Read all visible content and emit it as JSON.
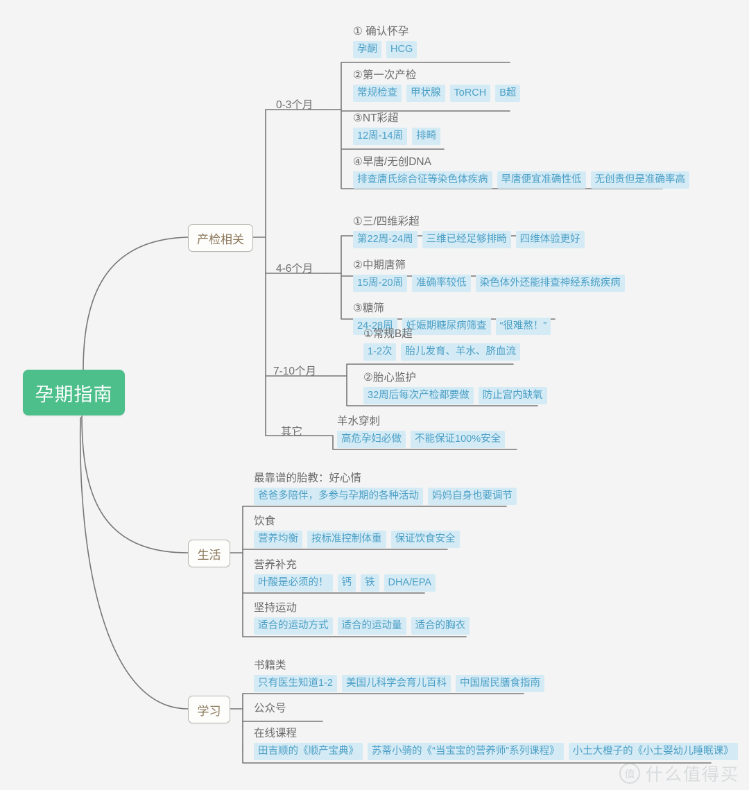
{
  "root": {
    "label": "孕期指南",
    "color": "#4cbf8b"
  },
  "theme": {
    "background": "#f4f4f4",
    "tag_background": "#d4ebf5",
    "tag_text": "#4c9fc6",
    "branch_text": "#8a7658",
    "link_color": "#777777"
  },
  "branches": [
    {
      "label": "产检相关",
      "groups": [
        {
          "label": "0-3个月",
          "leaves": [
            {
              "title": "① 确认怀孕",
              "tags": [
                "孕酮",
                "HCG"
              ]
            },
            {
              "title": "②第一次产检",
              "tags": [
                "常规检查",
                "甲状腺",
                "ToRCH",
                "B超"
              ]
            },
            {
              "title": "③NT彩超",
              "tags": [
                "12周-14周",
                "排畸"
              ]
            },
            {
              "title": "④早唐/无创DNA",
              "tags": [
                "排查唐氏综合征等染色体疾病",
                "早唐便宜准确性低",
                "无创贵但是准确率高"
              ]
            }
          ]
        },
        {
          "label": "4-6个月",
          "leaves": [
            {
              "title": "①三/四维彩超",
              "tags": [
                "第22周-24周",
                "三维已经足够排畸",
                "四维体验更好"
              ]
            },
            {
              "title": "②中期唐筛",
              "tags": [
                "15周-20周",
                "准确率较低",
                "染色体外还能排查神经系统疾病"
              ]
            },
            {
              "title": "③糖筛",
              "tags": [
                "24-28周",
                "妊娠期糖尿病筛查",
                "“很难熬！”"
              ]
            }
          ]
        },
        {
          "label": "7-10个月",
          "leaves": [
            {
              "title": "①常规B超",
              "tags": [
                "1-2次",
                "胎儿发育、羊水、脐血流"
              ]
            },
            {
              "title": "②胎心监护",
              "tags": [
                "32周后每次产检都要做",
                "防止宫内缺氧"
              ]
            }
          ]
        },
        {
          "label": "其它",
          "leaves": [
            {
              "title": "羊水穿刺",
              "tags": [
                "高危孕妇必做",
                "不能保证100%安全"
              ]
            }
          ]
        }
      ]
    },
    {
      "label": "生活",
      "groups": [
        {
          "label": "",
          "leaves": [
            {
              "title": "最靠谱的胎教：好心情",
              "tags": [
                "爸爸多陪伴，多参与孕期的各种活动",
                "妈妈自身也要调节"
              ]
            },
            {
              "title": "饮食",
              "tags": [
                "营养均衡",
                "按标准控制体重",
                "保证饮食安全"
              ]
            },
            {
              "title": "营养补充",
              "tags": [
                "叶酸是必须的！",
                "钙",
                "铁",
                "DHA/EPA"
              ]
            },
            {
              "title": "坚持运动",
              "tags": [
                "适合的运动方式",
                "适合的运动量",
                "适合的胸衣"
              ]
            }
          ]
        }
      ]
    },
    {
      "label": "学习",
      "groups": [
        {
          "label": "",
          "leaves": [
            {
              "title": "书籍类",
              "tags": [
                "只有医生知道1-2",
                "美国儿科学会育儿百科",
                "中国居民膳食指南"
              ]
            },
            {
              "title": "公众号",
              "tags": []
            },
            {
              "title": "在线课程",
              "tags": [
                "田吉顺的《顺产宝典》",
                "苏蒂小骑的《“当宝宝的营养师”系列课程》",
                "小土大橙子的《小土婴幼儿睡眠课》"
              ]
            }
          ]
        }
      ]
    }
  ],
  "watermark": {
    "badge": "值",
    "text": "什么值得买"
  }
}
